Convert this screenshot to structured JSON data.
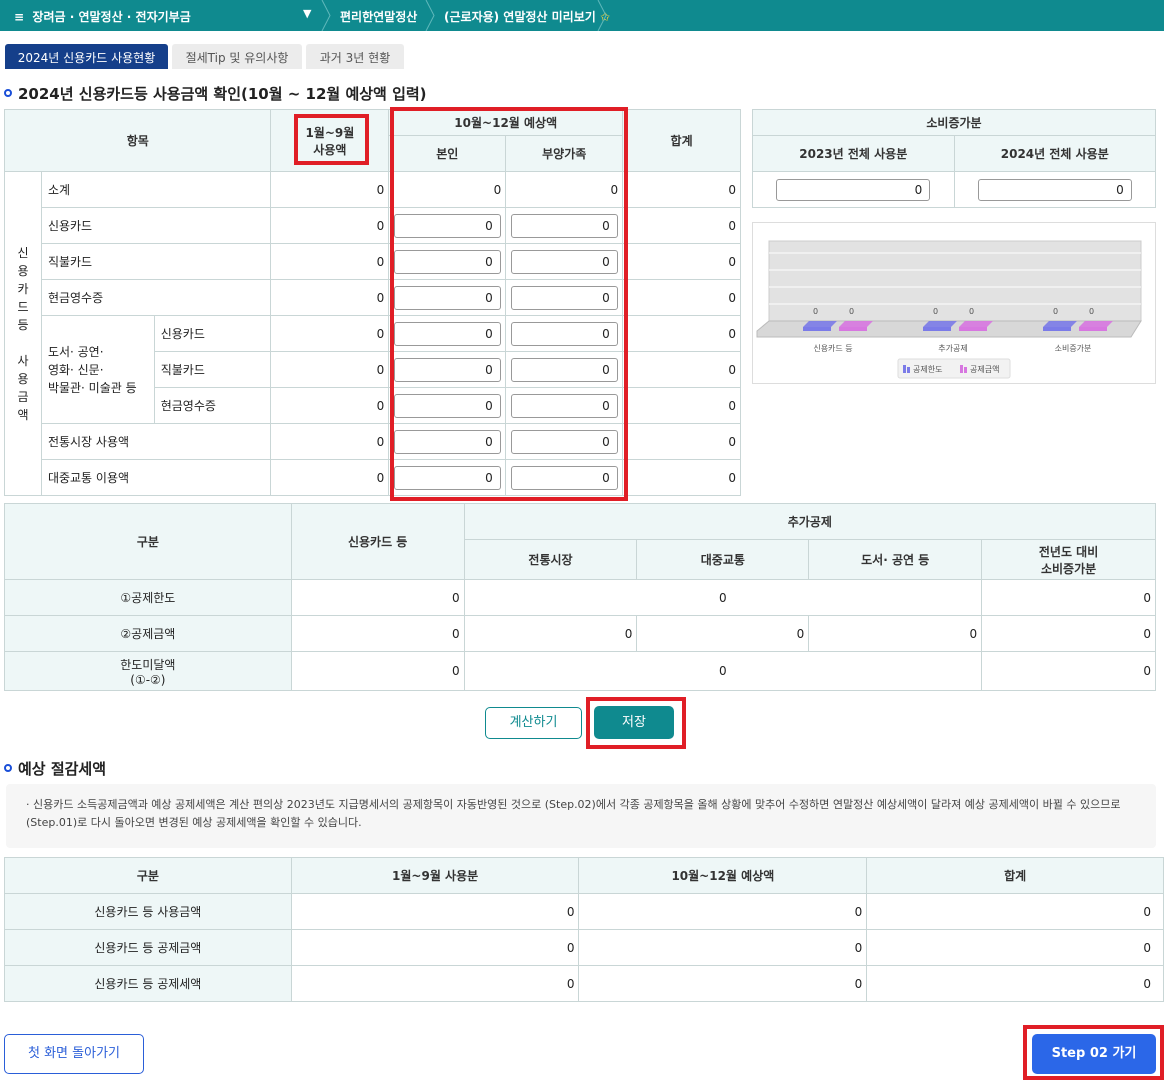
{
  "topbar": {
    "menu_label": "장려금 · 연말정산 · 전자기부금",
    "crumb1": "편리한연말정산",
    "crumb2": "(근로자용) 연말정산 미리보기",
    "star": "✩"
  },
  "tabs": [
    {
      "label": "2024년 신용카드 사용현황"
    },
    {
      "label": "절세Tip 및 유의사항"
    },
    {
      "label": "과거 3년 현황"
    }
  ],
  "section1_title": "2024년 신용카드등 사용금액 확인(10월 ~ 12월 예상액 입력)",
  "usage_table": {
    "h_item": "항목",
    "h_jan_sep_line1": "1월~9월",
    "h_jan_sep_line2": "사용액",
    "h_oct_dec": "10월~12월 예상액",
    "h_self": "본인",
    "h_dependent": "부양가족",
    "h_total": "합계",
    "side_label": [
      "신",
      "용",
      "카",
      "드",
      "등",
      "",
      "사",
      "용",
      "금",
      "액"
    ],
    "group_label_l1": "도서· 공연·",
    "group_label_l2": "영화· 신문·",
    "group_label_l3": "박물관· 미술관 등",
    "rows": [
      {
        "label": "소계",
        "jan_sep": "0",
        "self": "0",
        "dep": "0",
        "total": "0"
      },
      {
        "label": "신용카드",
        "jan_sep": "0",
        "self": "0",
        "dep": "0",
        "total": "0"
      },
      {
        "label": "직불카드",
        "jan_sep": "0",
        "self": "0",
        "dep": "0",
        "total": "0"
      },
      {
        "label": "현금영수증",
        "jan_sep": "0",
        "self": "0",
        "dep": "0",
        "total": "0"
      },
      {
        "label": "신용카드",
        "jan_sep": "0",
        "self": "0",
        "dep": "0",
        "total": "0"
      },
      {
        "label": "직불카드",
        "jan_sep": "0",
        "self": "0",
        "dep": "0",
        "total": "0"
      },
      {
        "label": "현금영수증",
        "jan_sep": "0",
        "self": "0",
        "dep": "0",
        "total": "0"
      },
      {
        "label": "전통시장 사용액",
        "jan_sep": "0",
        "self": "0",
        "dep": "0",
        "total": "0"
      },
      {
        "label": "대중교통 이용액",
        "jan_sep": "0",
        "self": "0",
        "dep": "0",
        "total": "0"
      }
    ]
  },
  "consumption_table": {
    "title": "소비증가분",
    "h_2023": "2023년 전체 사용분",
    "h_2024": "2024년 전체 사용분",
    "v_2023": "0",
    "v_2024": "0"
  },
  "chart_data": {
    "type": "bar",
    "categories": [
      "신용카드 등",
      "추가공제",
      "소비증가분"
    ],
    "series": [
      {
        "name": "공제한도",
        "values": [
          0,
          0,
          0
        ],
        "color": "#7b7be8"
      },
      {
        "name": "공제금액",
        "values": [
          0,
          0,
          0
        ],
        "color": "#d777e0"
      }
    ],
    "data_labels": [
      "0",
      "0",
      "0",
      "0",
      "0",
      "0"
    ],
    "legend": "bottom"
  },
  "deduction_table": {
    "h_category": "구분",
    "h_credit": "신용카드 등",
    "h_additional": "추가공제",
    "h_market": "전통시장",
    "h_transit": "대중교통",
    "h_books": "도서· 공연 등",
    "h_increase_l1": "전년도 대비",
    "h_increase_l2": "소비증가분",
    "row1_label": "①공제한도",
    "row1_credit": "0",
    "row1_additional": "0",
    "row1_increase": "0",
    "row2_label": "②공제금액",
    "row2_credit": "0",
    "row2_market": "0",
    "row2_transit": "0",
    "row2_books": "0",
    "row2_increase": "0",
    "row3_label_l1": "한도미달액",
    "row3_label_l2": "(①-②)",
    "row3_credit": "0",
    "row3_additional": "0",
    "row3_increase": "0"
  },
  "buttons": {
    "calculate": "계산하기",
    "save": "저장",
    "home": "첫 화면 돌아가기",
    "next": "Step 02 가기"
  },
  "section2_title": "예상 절감세액",
  "note_line1": "· 신용카드 소득공제금액과 예상 공제세액은 계산 편의상 2023년도 지급명세서의 공제항목이 자동반영된 것으로 (Step.02)에서 각종 공제항목을 올해 상황에 맞추어 수정하면 연말정산 예상세액이 달라져 예상 공제세액이 바뀔 수 있으므로",
  "note_line2": "(Step.01)로 다시 돌아오면 변경된 예상 공제세액을 확인할 수 있습니다.",
  "savings_table": {
    "h_category": "구분",
    "h_jan_sep": "1월~9월 사용분",
    "h_oct_dec": "10월~12월 예상액",
    "h_total": "합계",
    "rows": [
      {
        "label": "신용카드 등 사용금액",
        "jan_sep": "0",
        "oct_dec": "0",
        "total": "0"
      },
      {
        "label": "신용카드 등 공제금액",
        "jan_sep": "0",
        "oct_dec": "0",
        "total": "0"
      },
      {
        "label": "신용카드 등 공제세액",
        "jan_sep": "0",
        "oct_dec": "0",
        "total": "0"
      }
    ]
  }
}
